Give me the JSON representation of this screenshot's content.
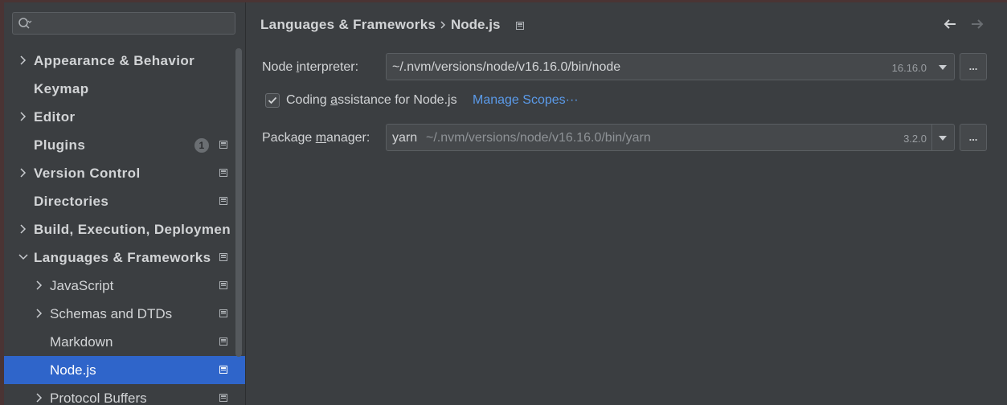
{
  "search": {
    "placeholder": "",
    "value": ""
  },
  "sidebar": {
    "items": [
      {
        "label": "Appearance & Behavior",
        "expandable": true,
        "expanded": false,
        "level": 0
      },
      {
        "label": "Keymap",
        "expandable": false,
        "level": 0
      },
      {
        "label": "Editor",
        "expandable": true,
        "expanded": false,
        "level": 0
      },
      {
        "label": "Plugins",
        "expandable": false,
        "level": 0,
        "badge": "1"
      },
      {
        "label": "Version Control",
        "expandable": true,
        "expanded": false,
        "level": 0
      },
      {
        "label": "Directories",
        "expandable": false,
        "level": 0
      },
      {
        "label": "Build, Execution, Deploymen",
        "expandable": true,
        "expanded": false,
        "level": 0
      },
      {
        "label": "Languages & Frameworks",
        "expandable": true,
        "expanded": true,
        "level": 0
      },
      {
        "label": "JavaScript",
        "expandable": true,
        "expanded": false,
        "level": 1
      },
      {
        "label": "Schemas and DTDs",
        "expandable": true,
        "expanded": false,
        "level": 1
      },
      {
        "label": "Markdown",
        "expandable": false,
        "level": 1
      },
      {
        "label": "Node.js",
        "expandable": false,
        "level": 1,
        "selected": true
      },
      {
        "label": "Protocol Buffers",
        "expandable": true,
        "expanded": false,
        "level": 1
      }
    ]
  },
  "header": {
    "breadcrumb_parent": "Languages & Frameworks",
    "breadcrumb_separator": "›",
    "breadcrumb_current": "Node.js"
  },
  "form": {
    "interpreter": {
      "label_pre": "Node ",
      "label_mnemonic": "i",
      "label_post": "nterpreter:",
      "value": "~/.nvm/versions/node/v16.16.0/bin/node",
      "version": "16.16.0",
      "browse_label": "..."
    },
    "coding_assistance": {
      "checked": true,
      "label_pre": "Coding ",
      "label_mnemonic": "a",
      "label_post": "ssistance for Node.js",
      "link": "Manage Scopes···"
    },
    "package_manager": {
      "label_pre": "Package ",
      "label_mnemonic": "m",
      "label_post": "anager:",
      "name": "yarn",
      "path": "~/.nvm/versions/node/v16.16.0/bin/yarn",
      "version": "3.2.0",
      "browse_label": "..."
    }
  },
  "colors": {
    "selection": "#2f65ca",
    "link": "#5b9bea",
    "background": "#3b3e41"
  }
}
